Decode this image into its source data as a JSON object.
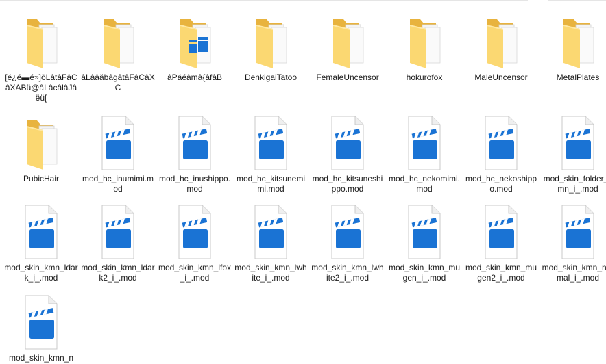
{
  "explorer": {
    "items": [
      {
        "label": "[é¿é▬é»]õLâtâFâCâXABü@âLâcâlâJâëü[",
        "type": "folder"
      },
      {
        "label": "âLââäbâgâtâFâCâXC",
        "type": "folder"
      },
      {
        "label": "âPáéâmâ{âfâB",
        "type": "folder-video"
      },
      {
        "label": "DenkigaiTatoo",
        "type": "folder"
      },
      {
        "label": "FemaleUncensor",
        "type": "folder"
      },
      {
        "label": "hokurofox",
        "type": "folder"
      },
      {
        "label": "MaleUncensor",
        "type": "folder"
      },
      {
        "label": "MetalPlates",
        "type": "folder"
      },
      {
        "label": "PubicHair",
        "type": "folder"
      },
      {
        "label": "mod_hc_inumimi.mod",
        "type": "mod"
      },
      {
        "label": "mod_hc_inushippo.mod",
        "type": "mod"
      },
      {
        "label": "mod_hc_kitsunemimi.mod",
        "type": "mod"
      },
      {
        "label": "mod_hc_kitsuneshippo.mod",
        "type": "mod"
      },
      {
        "label": "mod_hc_nekomimi.mod",
        "type": "mod"
      },
      {
        "label": "mod_hc_nekoshippo.mod",
        "type": "mod"
      },
      {
        "label": "mod_skin_folder_kmn_i_.mod",
        "type": "mod"
      },
      {
        "label": "mod_skin_kmn_ldark_i_.mod",
        "type": "mod"
      },
      {
        "label": "mod_skin_kmn_ldark2_i_.mod",
        "type": "mod"
      },
      {
        "label": "mod_skin_kmn_lfox_i_.mod",
        "type": "mod"
      },
      {
        "label": "mod_skin_kmn_lwhite_i_.mod",
        "type": "mod"
      },
      {
        "label": "mod_skin_kmn_lwhite2_i_.mod",
        "type": "mod"
      },
      {
        "label": "mod_skin_kmn_mugen_i_.mod",
        "type": "mod"
      },
      {
        "label": "mod_skin_kmn_mugen2_i_.mod",
        "type": "mod"
      },
      {
        "label": "mod_skin_kmn_normal_i_.mod",
        "type": "mod"
      },
      {
        "label": "mod_skin_kmn_n",
        "type": "mod"
      }
    ],
    "icons": {
      "folder": "folder-icon",
      "folder-video": "video-folder-icon",
      "mod": "video-file-icon"
    },
    "colors": {
      "folder_back": "#e8b33e",
      "folder_front": "#fbd872",
      "clapper_blue": "#1a73d4",
      "paper": "#ffffff"
    }
  }
}
